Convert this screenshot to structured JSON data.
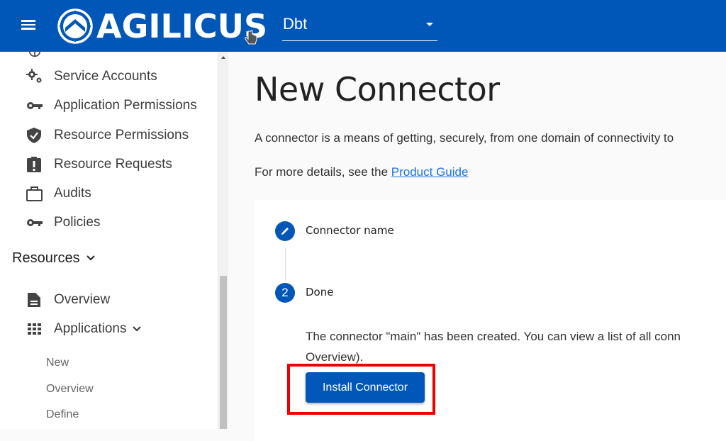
{
  "header": {
    "brand": "AGILICUS",
    "org_select": {
      "value": "Dbt"
    }
  },
  "sidebar": {
    "items": [
      {
        "label": "Service Accounts",
        "icon": "gears-icon"
      },
      {
        "label": "Application Permissions",
        "icon": "key-icon"
      },
      {
        "label": "Resource Permissions",
        "icon": "shield-check-icon"
      },
      {
        "label": "Resource Requests",
        "icon": "clipboard-alert-icon"
      },
      {
        "label": "Audits",
        "icon": "briefcase-icon"
      },
      {
        "label": "Policies",
        "icon": "key-icon"
      }
    ],
    "resources_section": {
      "label": "Resources",
      "items": [
        {
          "label": "Overview",
          "icon": "document-icon"
        },
        {
          "label": "Applications",
          "icon": "apps-grid-icon"
        }
      ],
      "applications_subitems": [
        "New",
        "Overview",
        "Define"
      ]
    }
  },
  "main": {
    "title": "New Connector",
    "description": "A connector is a means of getting, securely, from one domain of connectivity to",
    "details_prefix": "For more details, see the ",
    "details_link": "Product Guide",
    "stepper": {
      "steps": [
        {
          "label": "Connector name",
          "icon": "pencil-icon"
        },
        {
          "label": "Done",
          "number": "2"
        }
      ],
      "done_text_line1": "The connector \"main\" has been created. You can view a list of all conn",
      "done_text_line2": "Overview).",
      "install_button": "Install Connector"
    }
  },
  "colors": {
    "brand_blue": "#0057b8",
    "highlight_red": "#ee0000",
    "link": "#1a73e8"
  }
}
